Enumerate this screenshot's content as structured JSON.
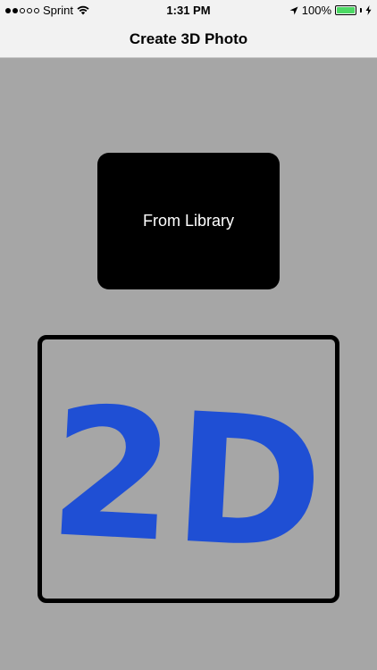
{
  "status_bar": {
    "carrier": "Sprint",
    "time": "1:31 PM",
    "battery_percent": "100%",
    "battery_level": 1.0,
    "signal_bars_filled": 2,
    "signal_bars_total": 5,
    "icons": [
      "wifi-icon",
      "location-arrow-icon",
      "charging-bolt-icon"
    ]
  },
  "nav": {
    "title": "Create 3D Photo"
  },
  "library_button": {
    "label": "From Library"
  },
  "preview": {
    "text": "2D",
    "color": "#1f4fd4"
  },
  "colors": {
    "background": "#a6a6a6",
    "battery_green": "#4cd964",
    "button_black": "#000000"
  }
}
